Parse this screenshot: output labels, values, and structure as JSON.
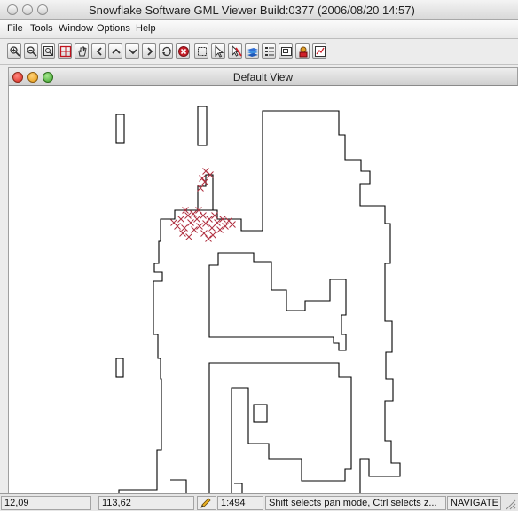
{
  "window": {
    "title": "Snowflake Software GML Viewer Build:0377 (2006/08/20 14:57)"
  },
  "menubar": {
    "items": [
      {
        "label": "File"
      },
      {
        "label": "Tools"
      },
      {
        "label": "Window"
      },
      {
        "label": "Options"
      },
      {
        "label": "Help"
      }
    ]
  },
  "toolbar": {
    "buttons": [
      {
        "icon": "zoom-in-icon"
      },
      {
        "icon": "zoom-out-icon"
      },
      {
        "icon": "zoom-box-icon"
      },
      {
        "icon": "zoom-extent-icon"
      },
      {
        "icon": "pan-hand-icon"
      },
      {
        "icon": "pan-left-icon"
      },
      {
        "icon": "pan-up-icon"
      },
      {
        "icon": "pan-down-icon"
      },
      {
        "icon": "pan-right-icon"
      },
      {
        "icon": "refresh-icon"
      },
      {
        "icon": "stop-icon"
      },
      {
        "icon": "select-box-icon"
      },
      {
        "icon": "pointer-icon"
      },
      {
        "icon": "clear-selection-icon"
      },
      {
        "icon": "layers-icon"
      },
      {
        "icon": "legend-icon"
      },
      {
        "icon": "overview-icon"
      },
      {
        "icon": "identify-icon"
      },
      {
        "icon": "chart-icon"
      }
    ]
  },
  "view": {
    "title": "Default View",
    "colors": {
      "outline": "#000000",
      "feature_markers": "#b03040"
    }
  },
  "statusbar": {
    "coord_x": "12,09",
    "coord_y": "113,62",
    "scale": "1:494",
    "message": "Shift selects pan mode, Ctrl selects z...",
    "mode": "NAVIGATE"
  }
}
